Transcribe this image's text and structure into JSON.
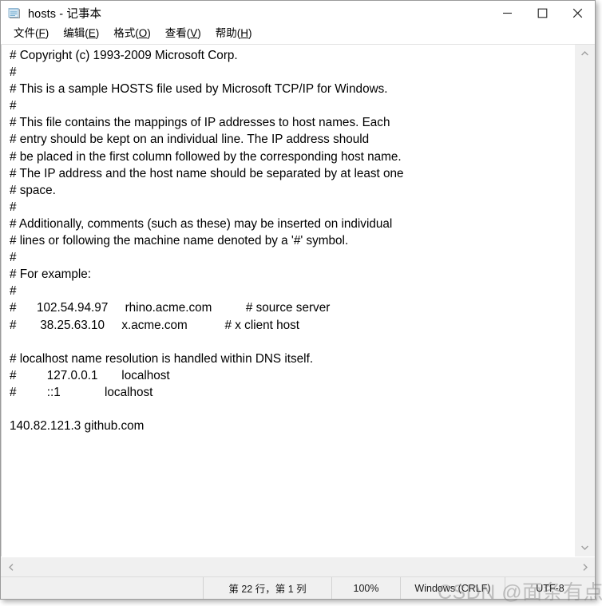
{
  "window": {
    "title": "hosts - 记事本",
    "icon": "notepad-icon",
    "controls": {
      "minimize": "最小化",
      "maximize": "最大化",
      "close": "关闭"
    }
  },
  "menubar": {
    "items": [
      {
        "label": "文件",
        "mnemonic": "F"
      },
      {
        "label": "编辑",
        "mnemonic": "E"
      },
      {
        "label": "格式",
        "mnemonic": "O"
      },
      {
        "label": "查看",
        "mnemonic": "V"
      },
      {
        "label": "帮助",
        "mnemonic": "H"
      }
    ]
  },
  "editor": {
    "lines": [
      "# Copyright (c) 1993-2009 Microsoft Corp.",
      "#",
      "# This is a sample HOSTS file used by Microsoft TCP/IP for Windows.",
      "#",
      "# This file contains the mappings of IP addresses to host names. Each",
      "# entry should be kept on an individual line. The IP address should",
      "# be placed in the first column followed by the corresponding host name.",
      "# The IP address and the host name should be separated by at least one",
      "# space.",
      "#",
      "# Additionally, comments (such as these) may be inserted on individual",
      "# lines or following the machine name denoted by a '#' symbol.",
      "#",
      "# For example:",
      "#",
      "#      102.54.94.97     rhino.acme.com          # source server",
      "#       38.25.63.10     x.acme.com           # x client host",
      "",
      "# localhost name resolution is handled within DNS itself.",
      "#         127.0.0.1       localhost",
      "#         ::1             localhost",
      "",
      "140.82.121.3 github.com"
    ]
  },
  "scrollbars": {
    "vertical": {
      "up_arrow": "chevron-up-icon",
      "down_arrow": "chevron-down-icon"
    },
    "horizontal": {
      "left_arrow": "chevron-left-icon",
      "right_arrow": "chevron-right-icon"
    }
  },
  "statusbar": {
    "position": "第 22 行，第 1 列",
    "zoom": "100%",
    "line_ending": "Windows (CRLF)",
    "encoding": "UTF-8"
  },
  "watermark": {
    "text": "CSDN @面条有点辣"
  }
}
